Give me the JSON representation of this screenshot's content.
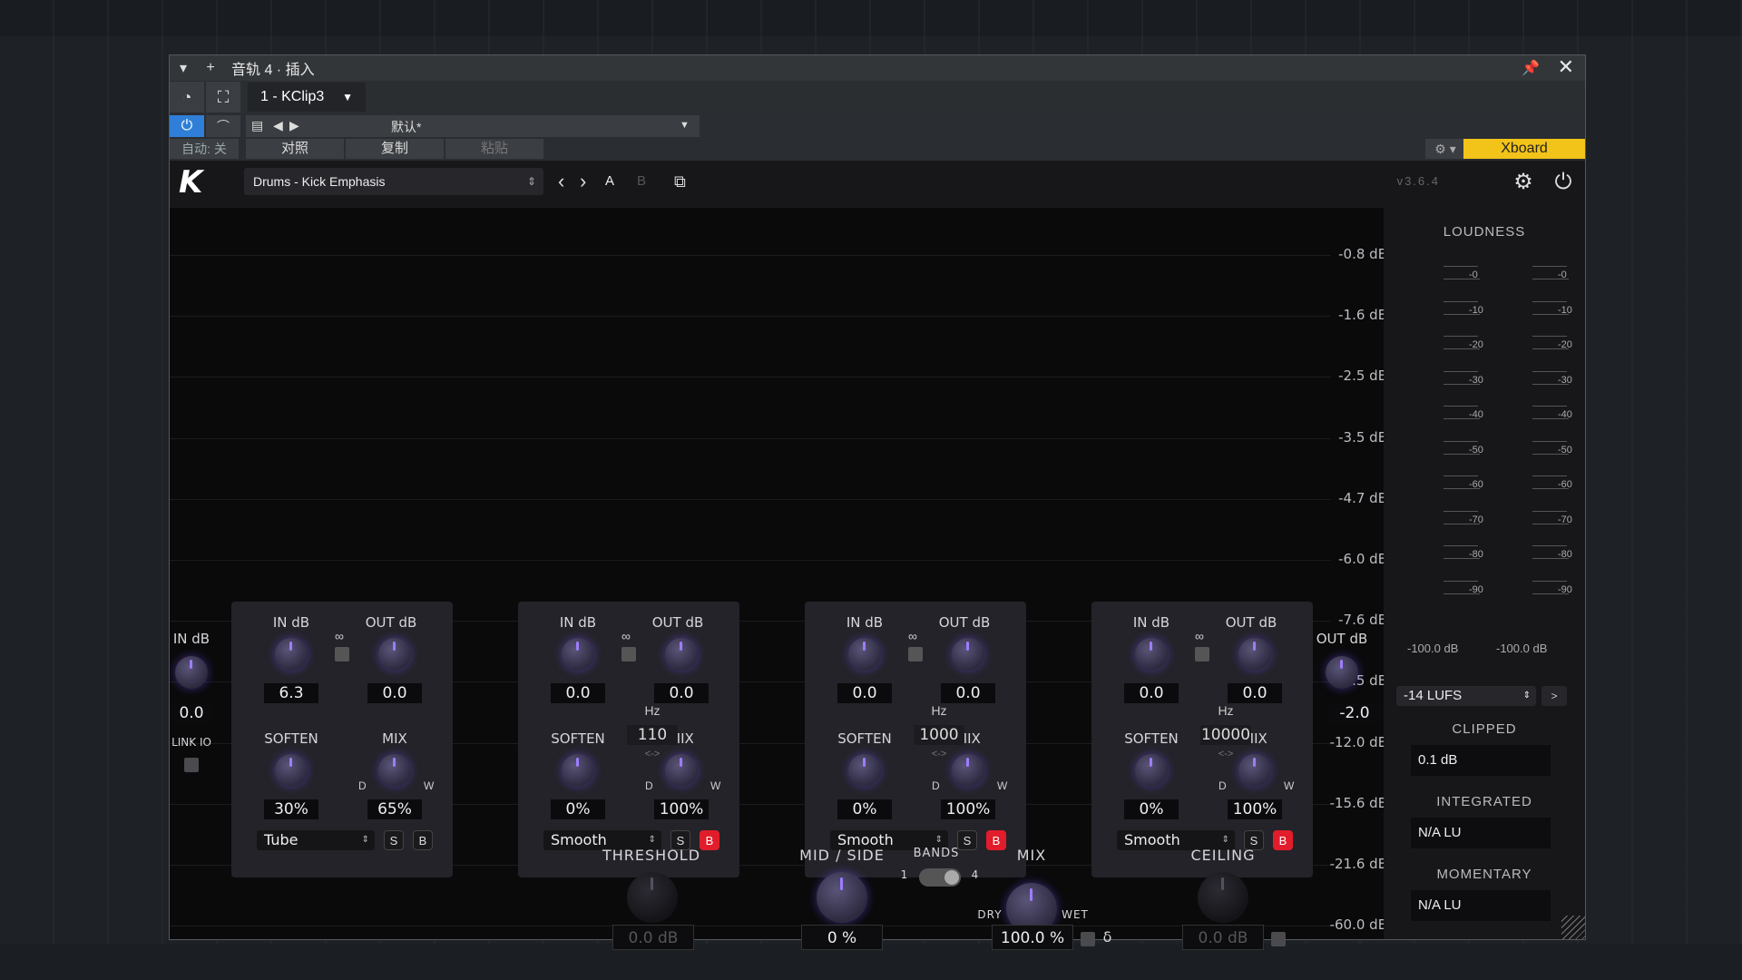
{
  "host": {
    "title": "音轨 4 · 插入",
    "plugin_slot": "1 - KClip3",
    "preset_name": "默认*",
    "auto_label": "自动: 关",
    "compare_label": "对照",
    "copy_label": "复制",
    "paste_label": "粘贴",
    "xboard_label": "Xboard"
  },
  "plugin": {
    "logo": "K",
    "preset": "Drums - Kick Emphasis",
    "ab_a": "A",
    "ab_b": "B",
    "version": "v3.6.4"
  },
  "db_scale": [
    "-0.8 dB",
    "-1.6 dB",
    "-2.5 dB",
    "-3.5 dB",
    "-4.7 dB",
    "-6.0 dB",
    "-7.6 dB",
    "-9.5 dB",
    "-12.0 dB",
    "-15.6 dB",
    "-21.6 dB",
    "-60.0 dB"
  ],
  "io": {
    "in_label": "IN dB",
    "in_value": "0.0",
    "link_label": "LINK IO",
    "out_label": "OUT dB",
    "out_value": "-2.0"
  },
  "bands": [
    {
      "in_label": "IN dB",
      "out_label": "OUT dB",
      "in_value": "6.3",
      "out_value": "0.0",
      "soften_label": "SOFTEN",
      "mix_label": "MIX",
      "soften_value": "30%",
      "mix_value": "65%",
      "mode": "Tube",
      "d": "D",
      "w": "W",
      "s": "S",
      "b": "B",
      "b_active": false
    },
    {
      "in_label": "IN dB",
      "out_label": "OUT dB",
      "in_value": "0.0",
      "out_value": "0.0",
      "soften_label": "SOFTEN",
      "mix_label": "MIX",
      "soften_value": "0%",
      "mix_value": "100%",
      "mode": "Smooth",
      "d": "D",
      "w": "W",
      "s": "S",
      "b": "B",
      "b_active": true
    },
    {
      "in_label": "IN dB",
      "out_label": "OUT dB",
      "in_value": "0.0",
      "out_value": "0.0",
      "soften_label": "SOFTEN",
      "mix_label": "MIX",
      "soften_value": "0%",
      "mix_value": "100%",
      "mode": "Smooth",
      "d": "D",
      "w": "W",
      "s": "S",
      "b": "B",
      "b_active": true
    },
    {
      "in_label": "IN dB",
      "out_label": "OUT dB",
      "in_value": "0.0",
      "out_value": "0.0",
      "soften_label": "SOFTEN",
      "mix_label": "MIX",
      "soften_value": "0%",
      "mix_value": "100%",
      "mode": "Smooth",
      "d": "D",
      "w": "W",
      "s": "S",
      "b": "B",
      "b_active": true
    }
  ],
  "crossovers": [
    {
      "unit": "Hz",
      "value": "110",
      "arrow": "<->"
    },
    {
      "unit": "Hz",
      "value": "1000",
      "arrow": "<->"
    },
    {
      "unit": "Hz",
      "value": "10000",
      "arrow": "<->"
    }
  ],
  "bottom": {
    "threshold_label": "THRESHOLD",
    "threshold_value": "0.0 dB",
    "midside_label": "MID / SIDE",
    "midside_value": "0 %",
    "bands_label": "BANDS",
    "bands_min": "1",
    "bands_max": "4",
    "mix_label": "MIX",
    "mix_value": "100.0 %",
    "dry": "DRY",
    "wet": "WET",
    "delta": "δ",
    "ceiling_label": "CEILING",
    "ceiling_value": "0.0 dB"
  },
  "loudness": {
    "title": "LOUDNESS",
    "scale": [
      "-0",
      "-10",
      "-20",
      "-30",
      "-40",
      "-50",
      "-60",
      "-70",
      "-80",
      "-90"
    ],
    "left_value": "-100.0 dB",
    "right_value": "-100.0 dB",
    "target": "-14 LUFS",
    "more": ">",
    "clipped_label": "CLIPPED",
    "clipped_value": "0.1 dB",
    "integrated_label": "INTEGRATED",
    "integrated_value": "N/A LU",
    "momentary_label": "MOMENTARY",
    "momentary_value": "N/A LU"
  }
}
